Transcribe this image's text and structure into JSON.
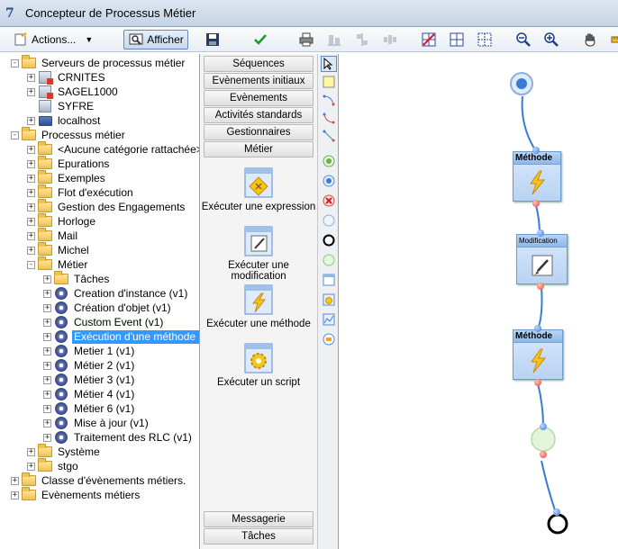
{
  "window": {
    "title": "Concepteur de Processus Métier",
    "app_icon": "7"
  },
  "toolbar": {
    "actions_label": "Actions...",
    "afficher_label": "Afficher"
  },
  "tree": {
    "servers_root": "Serveurs de processus métier",
    "servers": [
      "CRNITES",
      "SAGEL1000",
      "SYFRE",
      "localhost"
    ],
    "processes_root": "Processus métier",
    "folders": [
      "<Aucune catégorie rattachée>",
      "Epurations",
      "Exemples",
      "Flot d'exécution",
      "Gestion des Engagements",
      "Horloge",
      "Mail",
      "Michel",
      "Métier"
    ],
    "metier_children": [
      "Tâches",
      "Creation d'instance (v1)",
      "Création d'objet (v1)",
      "Custom Event (v1)",
      "Exécution d'une méthode (v",
      "Metier 1 (v1)",
      "Métier 2 (v1)",
      "Métier 3 (v1)",
      "Métier 4 (v1)",
      "Métier 6 (v1)",
      "Mise à jour (v1)",
      "Traitement des RLC (v1)"
    ],
    "after_metier": [
      "Système",
      "stgo"
    ],
    "other_roots": [
      "Classe d'évènements métiers.",
      "Evènements métiers"
    ],
    "selected": "Exécution d'une méthode (v"
  },
  "palette": {
    "categories_top": [
      "Séquences",
      "Evènements initiaux",
      "Evènements",
      "Activités standards",
      "Gestionnaires",
      "Métier"
    ],
    "items": [
      {
        "label": "Exécuter une expression",
        "icon_caption": "Expression"
      },
      {
        "label": "Exécuter une modification",
        "icon_caption": "Modification"
      },
      {
        "label": "Exécuter une méthode",
        "icon_caption": "Méthode"
      },
      {
        "label": "Exécuter un script",
        "icon_caption": "Script"
      }
    ],
    "categories_bottom": [
      "Messagerie",
      "Tâches"
    ]
  },
  "canvas": {
    "nodes": [
      {
        "title": "Méthode"
      },
      {
        "title": "Modification"
      },
      {
        "title": "Méthode"
      }
    ]
  },
  "colors": {
    "selection": "#3399ff",
    "link": "#3a7bd8",
    "port_in": "#3a7bd8",
    "port_out": "#e04a3a"
  }
}
